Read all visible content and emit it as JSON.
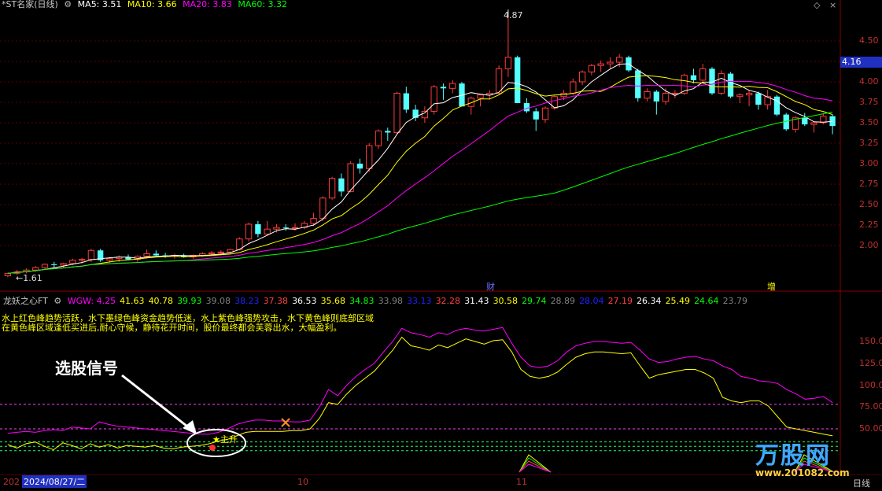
{
  "header": {
    "title": "*ST名家(日线)",
    "ma": [
      {
        "label": "MA5: 3.51",
        "color": "#ffffff"
      },
      {
        "label": "MA10: 3.66",
        "color": "#ffff00"
      },
      {
        "label": "MA20: 3.83",
        "color": "#ff00ff"
      },
      {
        "label": "MA60: 3.32",
        "color": "#00ff00"
      }
    ]
  },
  "price_axis": {
    "ticks": [
      "4.50",
      "4.25",
      "4.00",
      "3.75",
      "3.50",
      "3.25",
      "3.00",
      "2.75",
      "2.50",
      "2.25",
      "2.00"
    ],
    "current": "4.16"
  },
  "annotations": {
    "high": "4.87",
    "low": "1.61",
    "cai": "财",
    "zeng": "增",
    "signal": "选股信号",
    "zhusheng": "主升"
  },
  "indicator": {
    "name": "龙妖之心FT",
    "values": [
      {
        "v": "WGW: 4.25",
        "c": "#ff00ff"
      },
      {
        "v": "41.63",
        "c": "#ffff00"
      },
      {
        "v": "40.78",
        "c": "#ffff00"
      },
      {
        "v": "39.93",
        "c": "#00ff00"
      },
      {
        "v": "39.08",
        "c": "#808080"
      },
      {
        "v": "38.23",
        "c": "#2020ff"
      },
      {
        "v": "37.38",
        "c": "#ff4040"
      },
      {
        "v": "36.53",
        "c": "#ffffff"
      },
      {
        "v": "35.68",
        "c": "#ffff00"
      },
      {
        "v": "34.83",
        "c": "#00ff00"
      },
      {
        "v": "33.98",
        "c": "#808080"
      },
      {
        "v": "33.13",
        "c": "#2020ff"
      },
      {
        "v": "32.28",
        "c": "#ff4040"
      },
      {
        "v": "31.43",
        "c": "#ffffff"
      },
      {
        "v": "30.58",
        "c": "#ffff00"
      },
      {
        "v": "29.74",
        "c": "#00ff00"
      },
      {
        "v": "28.89",
        "c": "#808080"
      },
      {
        "v": "28.04",
        "c": "#2020ff"
      },
      {
        "v": "27.19",
        "c": "#ff4040"
      },
      {
        "v": "26.34",
        "c": "#ffffff"
      },
      {
        "v": "25.49",
        "c": "#ffff00"
      },
      {
        "v": "24.64",
        "c": "#00ff00"
      },
      {
        "v": "23.79",
        "c": "#808080"
      }
    ],
    "desc1": "水上红色峰趋势活跃，水下墨绿色峰资金趋势低迷，水上紫色峰强势攻击，水下黄色峰则底部区域",
    "desc2": "在黄色峰区域逢低买进后,耐心守候，静待花开时间，股价最终都会芙蓉出水，大幅盈利。",
    "ticks": [
      "150.0",
      "125.0",
      "100.0",
      "75.00",
      "50.00"
    ]
  },
  "footer": {
    "year_stub": "202",
    "date": "2024/08/27/二",
    "months": [
      "10",
      "11"
    ],
    "mode": "日线"
  },
  "watermark": {
    "brand": "万股网",
    "url": "www.201082.com"
  },
  "chart_data": [
    {
      "type": "candlestick",
      "title": "*ST名家(日线)",
      "ylim": [
        1.55,
        4.95
      ],
      "candles": [
        [
          1.63,
          1.66,
          1.61,
          1.66
        ],
        [
          1.66,
          1.7,
          1.64,
          1.68
        ],
        [
          1.68,
          1.72,
          1.66,
          1.7
        ],
        [
          1.7,
          1.75,
          1.68,
          1.73
        ],
        [
          1.73,
          1.78,
          1.71,
          1.77
        ],
        [
          1.77,
          1.8,
          1.73,
          1.76
        ],
        [
          1.76,
          1.79,
          1.72,
          1.78
        ],
        [
          1.78,
          1.84,
          1.76,
          1.82
        ],
        [
          1.82,
          1.85,
          1.78,
          1.83
        ],
        [
          1.83,
          1.96,
          1.8,
          1.94
        ],
        [
          1.94,
          1.96,
          1.8,
          1.82
        ],
        [
          1.82,
          1.86,
          1.79,
          1.84
        ],
        [
          1.84,
          1.88,
          1.8,
          1.86
        ],
        [
          1.86,
          1.89,
          1.82,
          1.83
        ],
        [
          1.83,
          1.88,
          1.8,
          1.87
        ],
        [
          1.87,
          1.95,
          1.84,
          1.9
        ],
        [
          1.9,
          1.94,
          1.86,
          1.88
        ],
        [
          1.88,
          1.91,
          1.85,
          1.87
        ],
        [
          1.87,
          1.9,
          1.84,
          1.88
        ],
        [
          1.88,
          1.9,
          1.85,
          1.86
        ],
        [
          1.86,
          1.89,
          1.84,
          1.88
        ],
        [
          1.88,
          1.92,
          1.86,
          1.9
        ],
        [
          1.9,
          1.93,
          1.87,
          1.91
        ],
        [
          1.91,
          1.94,
          1.88,
          1.92
        ],
        [
          1.92,
          1.96,
          1.9,
          1.95
        ],
        [
          1.95,
          2.1,
          1.94,
          2.08
        ],
        [
          2.08,
          2.28,
          2.05,
          2.26
        ],
        [
          2.26,
          2.3,
          2.1,
          2.14
        ],
        [
          2.14,
          2.3,
          2.12,
          2.2
        ],
        [
          2.2,
          2.26,
          2.16,
          2.22
        ],
        [
          2.22,
          2.26,
          2.18,
          2.21
        ],
        [
          2.21,
          2.27,
          2.18,
          2.22
        ],
        [
          2.22,
          2.3,
          2.2,
          2.27
        ],
        [
          2.27,
          2.4,
          2.24,
          2.33
        ],
        [
          2.33,
          2.6,
          2.3,
          2.58
        ],
        [
          2.58,
          2.84,
          2.56,
          2.82
        ],
        [
          2.82,
          2.88,
          2.6,
          2.66
        ],
        [
          2.66,
          3.03,
          2.65,
          3.0
        ],
        [
          3.0,
          3.06,
          2.88,
          2.94
        ],
        [
          2.94,
          3.25,
          2.9,
          3.22
        ],
        [
          3.22,
          3.42,
          3.18,
          3.4
        ],
        [
          3.4,
          3.44,
          3.28,
          3.38
        ],
        [
          3.38,
          3.88,
          3.36,
          3.86
        ],
        [
          3.86,
          3.94,
          3.62,
          3.66
        ],
        [
          3.66,
          3.72,
          3.52,
          3.56
        ],
        [
          3.56,
          3.7,
          3.5,
          3.64
        ],
        [
          3.64,
          3.96,
          3.6,
          3.94
        ],
        [
          3.94,
          3.98,
          3.78,
          3.92
        ],
        [
          3.92,
          4.02,
          3.86,
          3.98
        ],
        [
          3.98,
          4.0,
          3.72,
          3.7
        ],
        [
          3.7,
          3.82,
          3.6,
          3.8
        ],
        [
          3.8,
          3.84,
          3.7,
          3.84
        ],
        [
          3.84,
          3.9,
          3.78,
          3.86
        ],
        [
          3.86,
          4.2,
          3.84,
          4.16
        ],
        [
          4.16,
          4.87,
          4.06,
          4.3
        ],
        [
          4.3,
          4.32,
          3.74,
          3.74
        ],
        [
          3.74,
          3.8,
          3.62,
          3.64
        ],
        [
          3.64,
          3.68,
          3.4,
          3.54
        ],
        [
          3.54,
          3.7,
          3.5,
          3.68
        ],
        [
          3.68,
          3.84,
          3.66,
          3.82
        ],
        [
          3.82,
          3.9,
          3.78,
          3.86
        ],
        [
          3.86,
          4.04,
          3.84,
          4.0
        ],
        [
          4.0,
          4.14,
          3.96,
          4.12
        ],
        [
          4.12,
          4.22,
          4.08,
          4.2
        ],
        [
          4.2,
          4.26,
          4.12,
          4.22
        ],
        [
          4.22,
          4.3,
          4.16,
          4.24
        ],
        [
          4.24,
          4.34,
          4.18,
          4.3
        ],
        [
          4.3,
          4.32,
          4.12,
          4.14
        ],
        [
          4.14,
          4.16,
          3.76,
          3.8
        ],
        [
          3.8,
          3.92,
          3.76,
          3.88
        ],
        [
          3.88,
          3.9,
          3.6,
          3.76
        ],
        [
          3.76,
          3.92,
          3.72,
          3.86
        ],
        [
          3.86,
          3.9,
          3.8,
          3.86
        ],
        [
          3.86,
          4.1,
          3.84,
          4.08
        ],
        [
          4.08,
          4.16,
          3.98,
          4.02
        ],
        [
          4.02,
          4.22,
          3.98,
          4.16
        ],
        [
          4.16,
          4.18,
          3.84,
          3.86
        ],
        [
          3.86,
          4.14,
          3.84,
          4.1
        ],
        [
          4.1,
          4.12,
          3.8,
          3.82
        ],
        [
          3.82,
          3.86,
          3.74,
          3.84
        ],
        [
          3.84,
          3.9,
          3.7,
          3.86
        ],
        [
          3.86,
          3.88,
          3.66,
          3.72
        ],
        [
          3.72,
          3.9,
          3.66,
          3.82
        ],
        [
          3.82,
          3.84,
          3.58,
          3.6
        ],
        [
          3.6,
          3.62,
          3.4,
          3.42
        ],
        [
          3.42,
          3.58,
          3.38,
          3.56
        ],
        [
          3.56,
          3.62,
          3.46,
          3.48
        ],
        [
          3.48,
          3.52,
          3.38,
          3.5
        ],
        [
          3.5,
          3.62,
          3.48,
          3.58
        ],
        [
          3.58,
          3.6,
          3.36,
          3.46
        ]
      ],
      "ma": {
        "MA5": {
          "color": "#ffffff"
        },
        "MA10": {
          "color": "#ffff00"
        },
        "MA20": {
          "color": "#ff00ff"
        },
        "MA60": {
          "color": "#00ff00"
        }
      }
    },
    {
      "type": "line",
      "title": "龙妖之心FT",
      "ylim": [
        20,
        175
      ],
      "series": [
        {
          "name": "WGW",
          "color": "#ff00ff",
          "values": [
            45,
            46,
            47,
            46,
            48,
            49,
            48,
            52,
            51,
            50,
            58,
            55,
            53,
            52,
            51,
            50,
            49,
            48,
            47,
            46,
            45,
            44,
            44,
            46,
            50,
            55,
            58,
            60,
            60,
            59,
            59,
            58,
            58,
            60,
            75,
            95,
            88,
            100,
            110,
            118,
            125,
            138,
            150,
            165,
            160,
            158,
            155,
            160,
            158,
            163,
            165,
            163,
            162,
            164,
            166,
            148,
            132,
            122,
            120,
            122,
            128,
            138,
            145,
            148,
            150,
            150,
            149,
            148,
            149,
            140,
            130,
            126,
            127,
            130,
            132,
            133,
            130,
            128,
            122,
            118,
            110,
            108,
            105,
            104,
            102,
            95,
            90,
            84,
            85,
            87,
            80
          ]
        },
        {
          "name": "",
          "color": "#ffff00",
          "values": [
            32,
            28,
            33,
            35,
            30,
            26,
            34,
            31,
            27,
            33,
            29,
            32,
            28,
            31,
            30,
            29,
            31,
            28,
            27,
            29,
            30,
            31,
            33,
            36,
            38,
            42,
            46,
            47,
            47,
            47,
            47,
            48,
            48,
            50,
            62,
            80,
            78,
            90,
            100,
            108,
            116,
            128,
            140,
            155,
            145,
            143,
            140,
            146,
            143,
            148,
            153,
            150,
            147,
            151,
            152,
            138,
            118,
            110,
            108,
            110,
            115,
            124,
            132,
            136,
            138,
            138,
            137,
            136,
            137,
            122,
            108,
            112,
            114,
            116,
            118,
            118,
            114,
            108,
            86,
            82,
            80,
            82,
            82,
            76,
            64,
            52,
            50,
            48,
            46,
            44,
            42
          ]
        }
      ],
      "reference_lines": [
        50,
        78,
        35,
        30,
        25
      ]
    }
  ]
}
